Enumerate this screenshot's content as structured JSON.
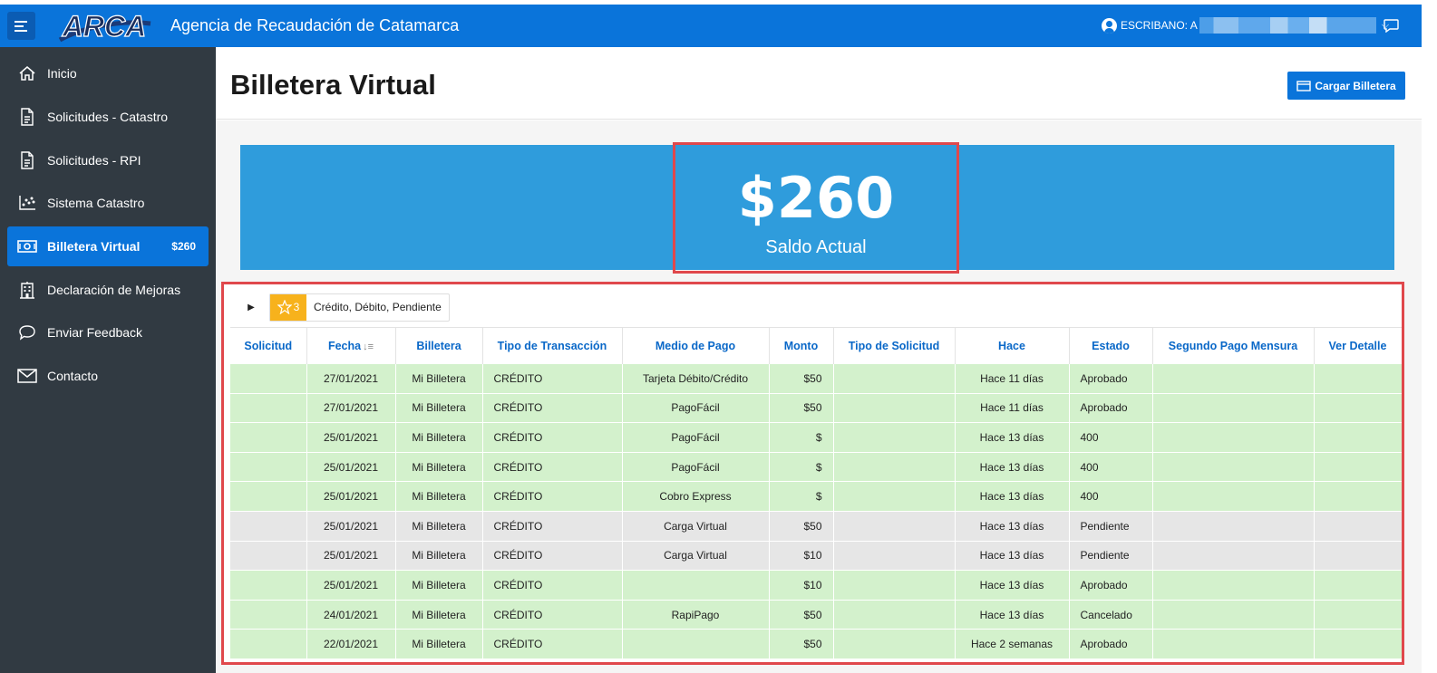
{
  "app": {
    "title": "Agencia de Recaudación de Catamarca",
    "logo_text": "ARCA",
    "user_label": "ESCRIBANO: A"
  },
  "colors": {
    "topbar": "#0a74da",
    "sidebar": "#313a42",
    "balance_band": "#2f9cdc",
    "highlight_border": "#e0484c",
    "row_green": "#d3f1cc",
    "row_grey": "#e6e6e6",
    "filter_star": "#f7b21c"
  },
  "sidebar": {
    "items": [
      {
        "label": "Inicio",
        "icon": "home-icon"
      },
      {
        "label": "Solicitudes - Catastro",
        "icon": "document-icon"
      },
      {
        "label": "Solicitudes - RPI",
        "icon": "document-icon"
      },
      {
        "label": "Sistema Catastro",
        "icon": "scatter-chart-icon"
      },
      {
        "label": "Billetera Virtual",
        "icon": "money-icon",
        "badge": "$260",
        "active": true
      },
      {
        "label": "Declaración de Mejoras",
        "icon": "building-icon"
      },
      {
        "label": "Enviar Feedback",
        "icon": "chat-bubble-icon"
      },
      {
        "label": "Contacto",
        "icon": "envelope-icon"
      }
    ]
  },
  "page": {
    "title": "Billetera Virtual",
    "cargar_label": "Cargar Billetera"
  },
  "balance": {
    "value": "$260",
    "label": "Saldo Actual"
  },
  "filter": {
    "count": "3",
    "text": "Crédito, Débito, Pendiente"
  },
  "table": {
    "headers": [
      "Solicitud",
      "Fecha",
      "Billetera",
      "Tipo de Transacción",
      "Medio de Pago",
      "Monto",
      "Tipo de Solicitud",
      "Hace",
      "Estado",
      "Segundo Pago Mensura",
      "Ver Detalle"
    ],
    "rows": [
      {
        "style": "green",
        "cells": [
          "",
          "27/01/2021",
          "Mi Billetera",
          "CRÉDITO",
          "Tarjeta Débito/Crédito",
          "$50",
          "",
          "Hace 11 días",
          "Aprobado",
          "",
          ""
        ]
      },
      {
        "style": "green",
        "cells": [
          "",
          "27/01/2021",
          "Mi Billetera",
          "CRÉDITO",
          "PagoFácil",
          "$50",
          "",
          "Hace 11 días",
          "Aprobado",
          "",
          ""
        ]
      },
      {
        "style": "green",
        "cells": [
          "",
          "25/01/2021",
          "Mi Billetera",
          "CRÉDITO",
          "PagoFácil",
          "$",
          "",
          "Hace 13 días",
          "400",
          "",
          ""
        ]
      },
      {
        "style": "green",
        "cells": [
          "",
          "25/01/2021",
          "Mi Billetera",
          "CRÉDITO",
          "PagoFácil",
          "$",
          "",
          "Hace 13 días",
          "400",
          "",
          ""
        ]
      },
      {
        "style": "green",
        "cells": [
          "",
          "25/01/2021",
          "Mi Billetera",
          "CRÉDITO",
          "Cobro Express",
          "$",
          "",
          "Hace 13 días",
          "400",
          "",
          ""
        ]
      },
      {
        "style": "grey",
        "cells": [
          "",
          "25/01/2021",
          "Mi Billetera",
          "CRÉDITO",
          "Carga Virtual",
          "$50",
          "",
          "Hace 13 días",
          "Pendiente",
          "",
          ""
        ]
      },
      {
        "style": "grey",
        "cells": [
          "",
          "25/01/2021",
          "Mi Billetera",
          "CRÉDITO",
          "Carga Virtual",
          "$10",
          "",
          "Hace 13 días",
          "Pendiente",
          "",
          ""
        ]
      },
      {
        "style": "green",
        "cells": [
          "",
          "25/01/2021",
          "Mi Billetera",
          "CRÉDITO",
          "",
          "$10",
          "",
          "Hace 13 días",
          "Aprobado",
          "",
          ""
        ]
      },
      {
        "style": "green",
        "cells": [
          "",
          "24/01/2021",
          "Mi Billetera",
          "CRÉDITO",
          "RapiPago",
          "$50",
          "",
          "Hace 13 días",
          "Cancelado",
          "",
          ""
        ]
      },
      {
        "style": "green",
        "cells": [
          "",
          "22/01/2021",
          "Mi Billetera",
          "CRÉDITO",
          "",
          "$50",
          "",
          "Hace 2 semanas",
          "Aprobado",
          "",
          ""
        ]
      }
    ]
  }
}
